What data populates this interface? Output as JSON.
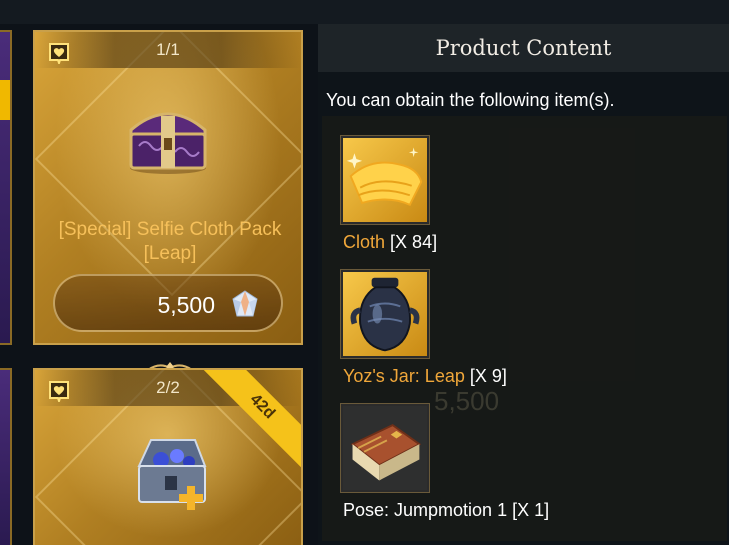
{
  "cards": [
    {
      "count": "1/1",
      "name": "[Special] Selfie Cloth Pack [Leap]",
      "price": "5,500",
      "icons": {
        "favorite": "heart-icon",
        "currency": "crystal-icon",
        "product": "chest-icon"
      }
    },
    {
      "count": "2/2",
      "ribbon": "42d",
      "icons": {
        "favorite": "heart-icon",
        "product": "gem-chest-icon"
      }
    }
  ],
  "panel": {
    "title": "Product Content",
    "description": "You can obtain the following item(s).",
    "background_price": "5,500",
    "items": [
      {
        "name": "Cloth",
        "qty": "[X 84]",
        "name_color": "#f0a73a",
        "icon": "cloth-icon"
      },
      {
        "name": "Yoz's Jar: Leap",
        "qty": "[X 9]",
        "name_color": "#f0a73a",
        "icon": "jar-icon"
      },
      {
        "name": "Pose: Jumpmotion 1",
        "qty": "[X 1]",
        "name_color": "#ffffff",
        "icon": "book-icon"
      }
    ]
  },
  "colors": {
    "accent_gold": "#f6c05a",
    "card_border": "#c9a04a",
    "ribbon_yellow": "#f5c21a",
    "panel_bg": "#0f1419"
  }
}
